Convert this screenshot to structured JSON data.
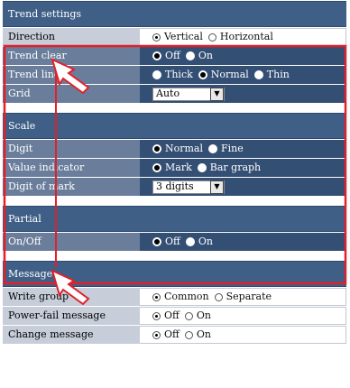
{
  "trend_settings": {
    "title": "Trend settings",
    "direction": {
      "label": "Direction",
      "opt1": "Vertical",
      "opt2": "Horizontal"
    },
    "trend_clear": {
      "label": "Trend clear",
      "opt1": "Off",
      "opt2": "On"
    },
    "trend_line": {
      "label": "Trend line",
      "opt1": "Thick",
      "opt2": "Normal",
      "opt3": "Thin"
    },
    "grid": {
      "label": "Grid",
      "value": "Auto"
    }
  },
  "scale": {
    "title": "Scale",
    "digit": {
      "label": "Digit",
      "opt1": "Normal",
      "opt2": "Fine"
    },
    "value_indicator": {
      "label": "Value indicator",
      "opt1": "Mark",
      "opt2": "Bar graph"
    },
    "digit_of_mark": {
      "label": "Digit of mark",
      "value": "3 digits"
    }
  },
  "partial": {
    "title": "Partial",
    "onoff": {
      "label": "On/Off",
      "opt1": "Off",
      "opt2": "On"
    }
  },
  "message": {
    "title": "Message",
    "write_group": {
      "label": "Write group",
      "opt1": "Common",
      "opt2": "Separate"
    },
    "power_fail": {
      "label": "Power-fail message",
      "opt1": "Off",
      "opt2": "On"
    },
    "change_message": {
      "label": "Change message",
      "opt1": "Off",
      "opt2": "On"
    }
  },
  "colors": {
    "header": "#3f5f87",
    "highlight_border": "#e0202a"
  }
}
